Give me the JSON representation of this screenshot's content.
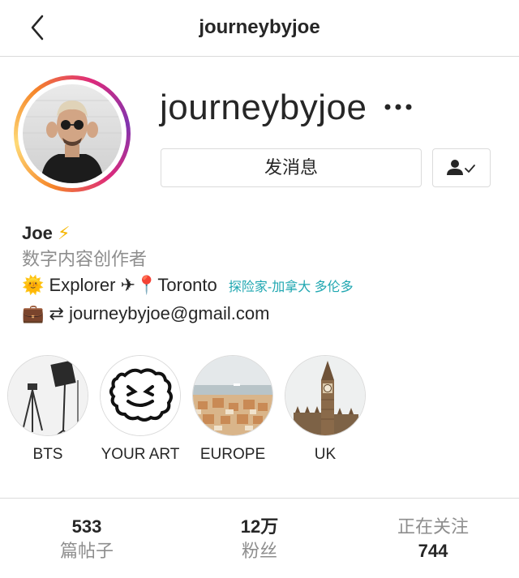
{
  "header": {
    "title": "journeybyjoe",
    "back_icon": "chevron-left-icon"
  },
  "profile": {
    "username": "journeybyjoe",
    "message_button": "发消息",
    "more_icon": "ellipsis-icon",
    "follow_icon": "person-check-icon",
    "ring_colors": [
      "#f58529",
      "#feda77",
      "#dd2a7b",
      "#8134af"
    ]
  },
  "bio": {
    "name": "Joe",
    "name_emoji": "⚡",
    "category": "数字内容创作者",
    "line3_emoji": "🌞",
    "line3_text": "Explorer ✈📍Toronto",
    "line3_tags": "探险家-加拿大 多伦多",
    "line4_emoji": "💼",
    "line4_text": "⇄ journeybyjoe@gmail.com",
    "tag_color": "#20a7b1"
  },
  "highlights": [
    {
      "label": "BTS"
    },
    {
      "label": "YOUR ART"
    },
    {
      "label": "EUROPE"
    },
    {
      "label": "UK"
    }
  ],
  "stats": {
    "posts": {
      "value": "533",
      "label": "篇帖子"
    },
    "followers": {
      "value": "12万",
      "label": "粉丝"
    },
    "following": {
      "label": "正在关注",
      "value": "744"
    }
  }
}
